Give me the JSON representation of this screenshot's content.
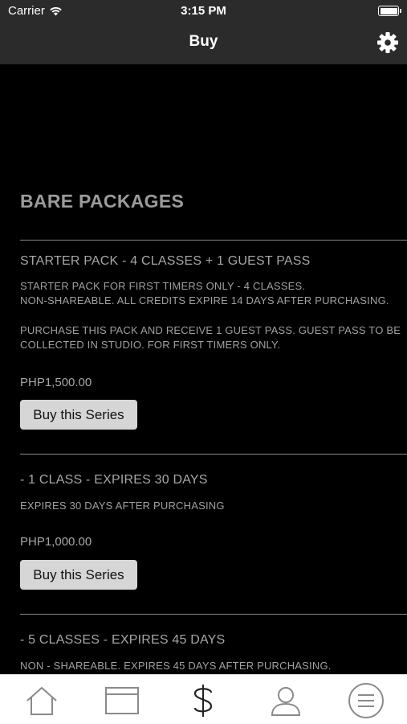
{
  "status_bar": {
    "carrier": "Carrier",
    "time": "3:15 PM"
  },
  "nav": {
    "title": "Buy",
    "settings_icon": "gear-icon"
  },
  "section": {
    "title": "BARE PACKAGES"
  },
  "packages": [
    {
      "name": "STARTER PACK - 4 CLASSES + 1 GUEST PASS",
      "desc": [
        "STARTER PACK FOR FIRST TIMERS ONLY - 4 CLASSES.",
        "NON-SHAREABLE. ALL CREDITS EXPIRE 14 DAYS AFTER PURCHASING.",
        "",
        "PURCHASE THIS PACK AND RECEIVE 1 GUEST PASS. GUEST PASS TO BE",
        "COLLECTED IN STUDIO. FOR FIRST TIMERS ONLY."
      ],
      "price": "PHP1,500.00",
      "button": "Buy this Series"
    },
    {
      "name": "- 1 CLASS - EXPIRES 30 DAYS",
      "desc": [
        "EXPIRES 30 DAYS AFTER PURCHASING"
      ],
      "price": "PHP1,000.00",
      "button": "Buy this Series"
    },
    {
      "name": "- 5 CLASSES - EXPIRES 45 DAYS",
      "desc": [
        "NON - SHAREABLE. EXPIRES 45 DAYS AFTER PURCHASING."
      ]
    }
  ],
  "tabs": [
    {
      "icon": "home-icon"
    },
    {
      "icon": "calendar-icon"
    },
    {
      "icon": "dollar-icon",
      "active": true
    },
    {
      "icon": "profile-icon"
    },
    {
      "icon": "menu-icon"
    }
  ]
}
